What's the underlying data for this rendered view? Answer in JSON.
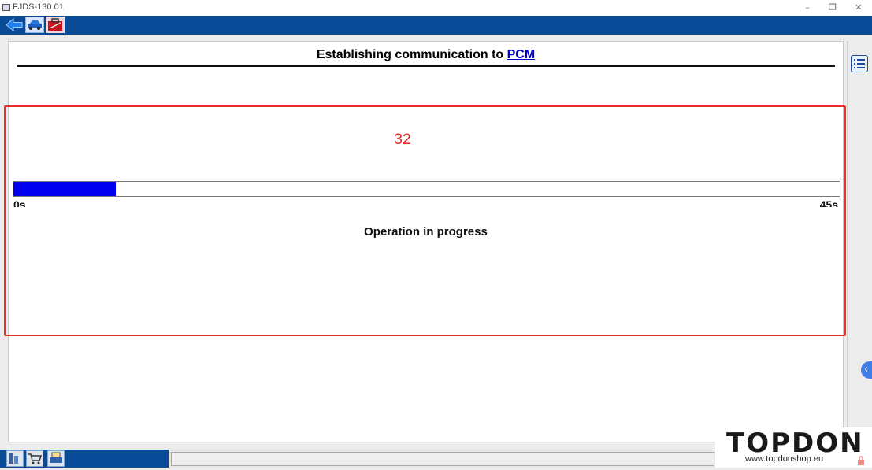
{
  "window": {
    "title": "FJDS-130.01",
    "controls": {
      "minimize": "–",
      "restore": "❐",
      "close": "✕"
    }
  },
  "toolbar": {
    "icons": [
      "back-arrow-icon",
      "vehicle-icon",
      "toolbox-icon"
    ]
  },
  "header": {
    "prefix": "Establishing communication to ",
    "module": "PCM"
  },
  "overlay": {
    "counter": "32",
    "color": "#e8302a"
  },
  "progress": {
    "fraction": 0.124,
    "min_label": "0s",
    "max_label": "45s",
    "fill_color": "#0000ee"
  },
  "status": {
    "message": "Operation in progress"
  },
  "taskbar": {
    "icons": [
      "data-log-icon",
      "shopping-cart-icon",
      "print-icon"
    ]
  },
  "watermark": {
    "brand": "TOPDON",
    "url": "www.topdonshop.eu"
  },
  "colors": {
    "toolbar_blue": "#0a4b98",
    "link_blue": "#0000cc"
  }
}
